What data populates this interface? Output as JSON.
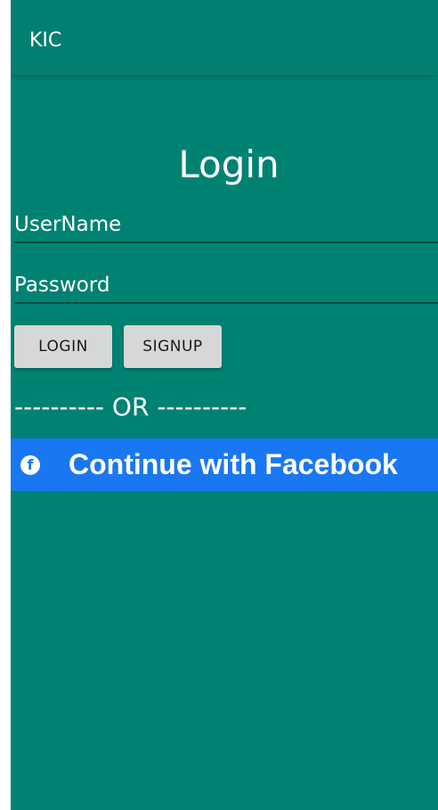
{
  "app_bar": {
    "title": "KIC"
  },
  "page": {
    "title": "Login"
  },
  "form": {
    "username_placeholder": "UserName",
    "password_placeholder": "Password",
    "login_label": "LOGIN",
    "signup_label": "SIGNUP"
  },
  "divider": {
    "text": "---------- OR ----------"
  },
  "facebook": {
    "label": "Continue with Facebook",
    "icon": "facebook-icon",
    "icon_glyph": "f"
  },
  "colors": {
    "background": "#008272",
    "facebook_blue": "#1a77f2",
    "button_gray": "#d6d7d7"
  }
}
